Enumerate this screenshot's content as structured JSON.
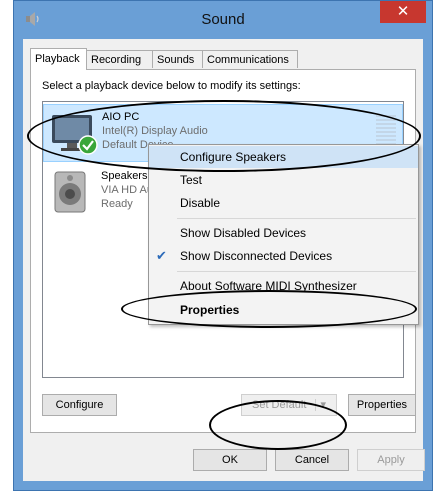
{
  "window": {
    "title": "Sound",
    "close_symbol": "✕"
  },
  "tabs": [
    {
      "label": "Playback",
      "active": true
    },
    {
      "label": "Recording"
    },
    {
      "label": "Sounds"
    },
    {
      "label": "Communications"
    }
  ],
  "playback": {
    "instruction": "Select a playback device below to modify its settings:",
    "devices": [
      {
        "name": "AIO PC",
        "driver": "Intel(R) Display Audio",
        "status": "Default Device",
        "icon": "monitor-icon",
        "badge": "green-check-icon",
        "selected": true
      },
      {
        "name": "Speakers",
        "driver": "VIA HD Audio",
        "status": "Ready",
        "icon": "speaker-icon"
      }
    ],
    "buttons": {
      "configure": "Configure",
      "set_default": "Set Default",
      "properties": "Properties"
    }
  },
  "context_menu": {
    "items": [
      {
        "label": "Configure Speakers",
        "highlighted": true
      },
      {
        "label": "Test"
      },
      {
        "label": "Disable"
      },
      {
        "label": "Show Disabled Devices",
        "checked": false
      },
      {
        "label": "Show Disconnected Devices",
        "checked": true
      },
      {
        "label": "About Software MIDI Synthesizer"
      },
      {
        "label": "Properties",
        "bold": true
      }
    ]
  },
  "dialog_buttons": {
    "ok": "OK",
    "cancel": "Cancel",
    "apply": "Apply"
  },
  "colors": {
    "title_bar": "#6a9fd6",
    "close_button": "#c7372f",
    "selection": "#cde8ff",
    "menu_highlight": "#cfe3f6"
  }
}
